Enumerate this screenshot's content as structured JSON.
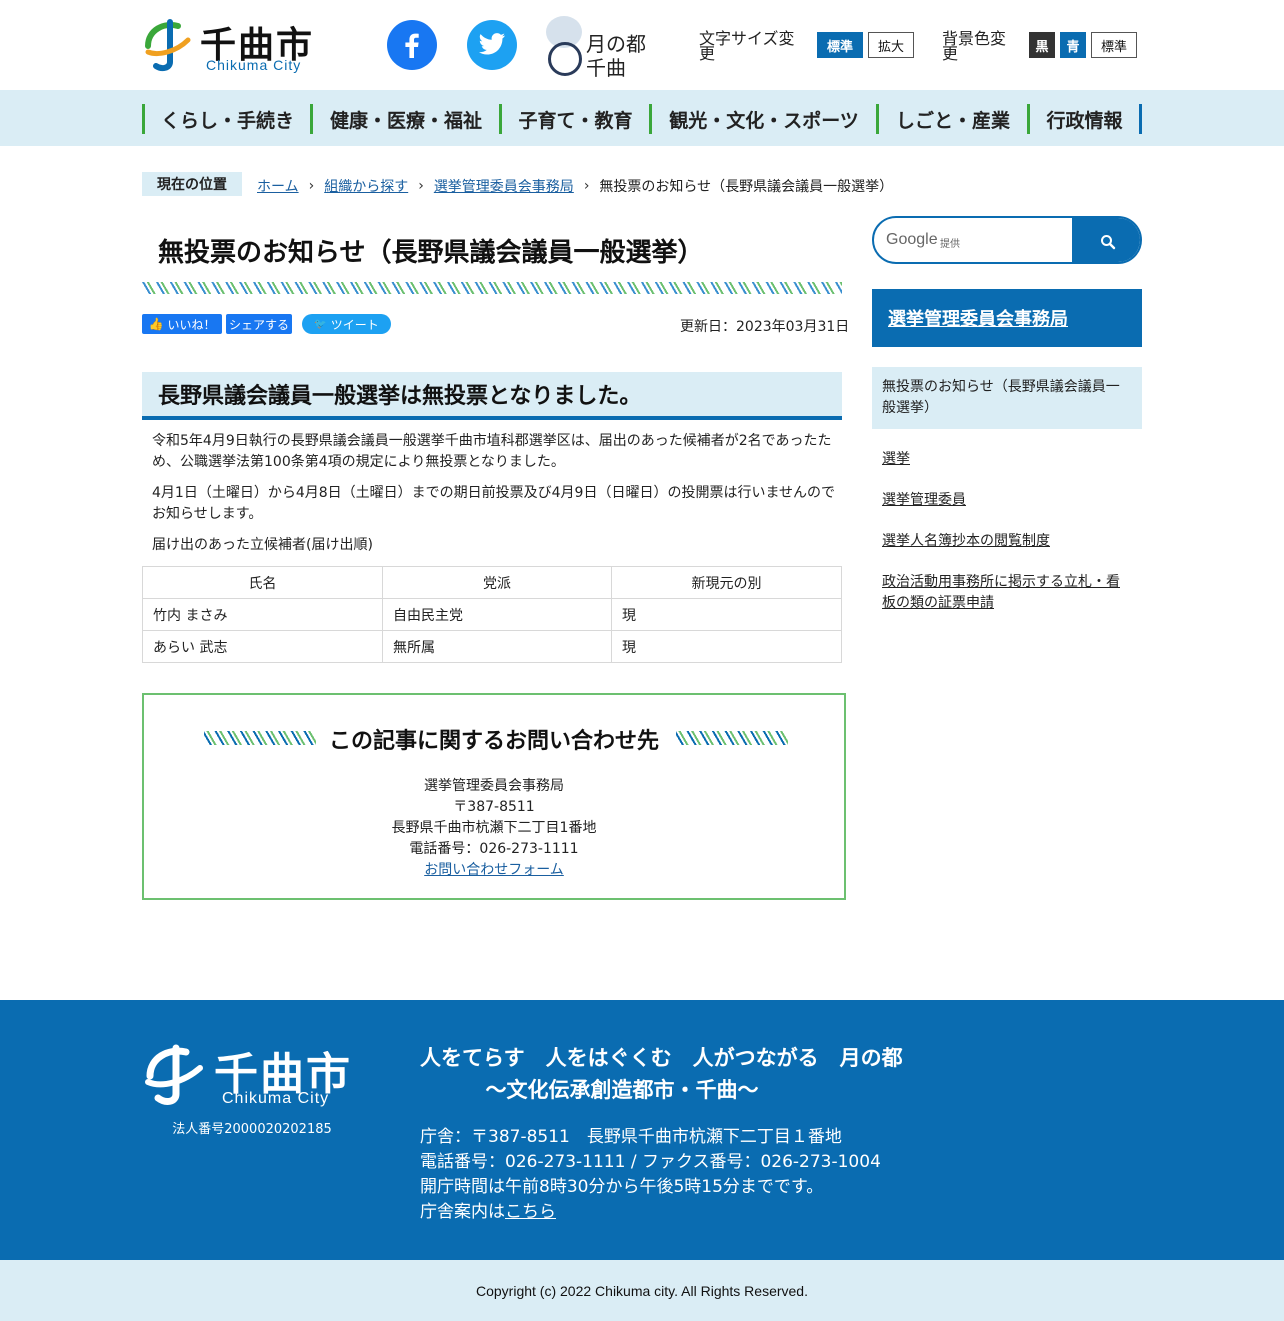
{
  "header": {
    "logo_jp": "千曲市",
    "logo_en": "Chikuma City",
    "tsuki_line1": "月の都",
    "tsuki_line2": "千曲",
    "font_size_label": "文字サイズ変更",
    "font_standard": "標準",
    "font_large": "拡大",
    "bg_label": "背景色変更",
    "bg_black": "黒",
    "bg_blue": "青",
    "bg_standard": "標準",
    "icons": [
      "facebook-icon",
      "twitter-icon"
    ]
  },
  "nav": {
    "items": [
      "くらし・手続き",
      "健康・医療・福祉",
      "子育て・教育",
      "観光・文化・スポーツ",
      "しごと・産業",
      "行政情報"
    ]
  },
  "breadcrumb": {
    "label": "現在の位置",
    "items": [
      "ホーム",
      "組織から探す",
      "選挙管理委員会事務局",
      "無投票のお知らせ（長野県議会議員一般選挙）"
    ]
  },
  "main": {
    "title": "無投票のお知らせ（長野県議会議員一般選挙）",
    "like": "いいね！",
    "share": "シェアする",
    "tweet": "ツイート",
    "updated": "更新日：2023年03月31日",
    "heading": "長野県議会議員一般選挙は無投票となりました。",
    "para1": "令和5年4月9日執行の長野県議会議員一般選挙千曲市埴科郡選挙区は、届出のあった候補者が2名であったため、公職選挙法第100条第4項の規定により無投票となりました。",
    "para2": "4月1日（土曜日）から4月8日（土曜日）までの期日前投票及び4月9日（日曜日）の投開票は行いませんのでお知らせします。",
    "para3": "届け出のあった立候補者(届け出順)",
    "table": {
      "headers": [
        "氏名",
        "党派",
        "新現元の別"
      ],
      "rows": [
        [
          "竹内 まさみ",
          "自由民主党",
          "現"
        ],
        [
          "あらい 武志",
          "無所属",
          "現"
        ]
      ]
    }
  },
  "contact": {
    "title": "この記事に関するお問い合わせ先",
    "dept": "選挙管理委員会事務局",
    "zip": "〒387-8511",
    "address": "長野県千曲市杭瀬下二丁目1番地",
    "tel": "電話番号：026-273-1111",
    "form": "お問い合わせフォーム"
  },
  "sidebar": {
    "search_brand": "Google",
    "search_sub": "提供",
    "heading": "選挙管理委員会事務局",
    "current": "無投票のお知らせ（長野県議会議員一般選挙）",
    "links": [
      "選挙",
      "選挙管理委員",
      "選挙人名簿抄本の閲覧制度",
      "政治活動用事務所に掲示する立札・看板の類の証票申請"
    ]
  },
  "footer": {
    "logo_jp": "千曲市",
    "logo_en": "Chikuma City",
    "corp_no": "法人番号2000020202185",
    "slogan": "人をてらす　人をはぐくむ　人がつながる　月の都",
    "slogan2": "～文化伝承創造都市・千曲～",
    "address": "庁舎：〒387-8511　長野県千曲市杭瀬下二丁目１番地",
    "phone": "電話番号：026-273-1111 / ファクス番号：026-273-1004",
    "hours": "開庁時間は午前8時30分から午後5時15分までです。",
    "guide_prefix": "庁舎案内は",
    "guide_link": "こちら",
    "copyright": "Copyright (c) 2022 Chikuma city. All Rights Reserved."
  },
  "colors": {
    "brand_blue": "#0a6cb1",
    "accent_green": "#6cc070",
    "light_blue": "#daedf5"
  }
}
